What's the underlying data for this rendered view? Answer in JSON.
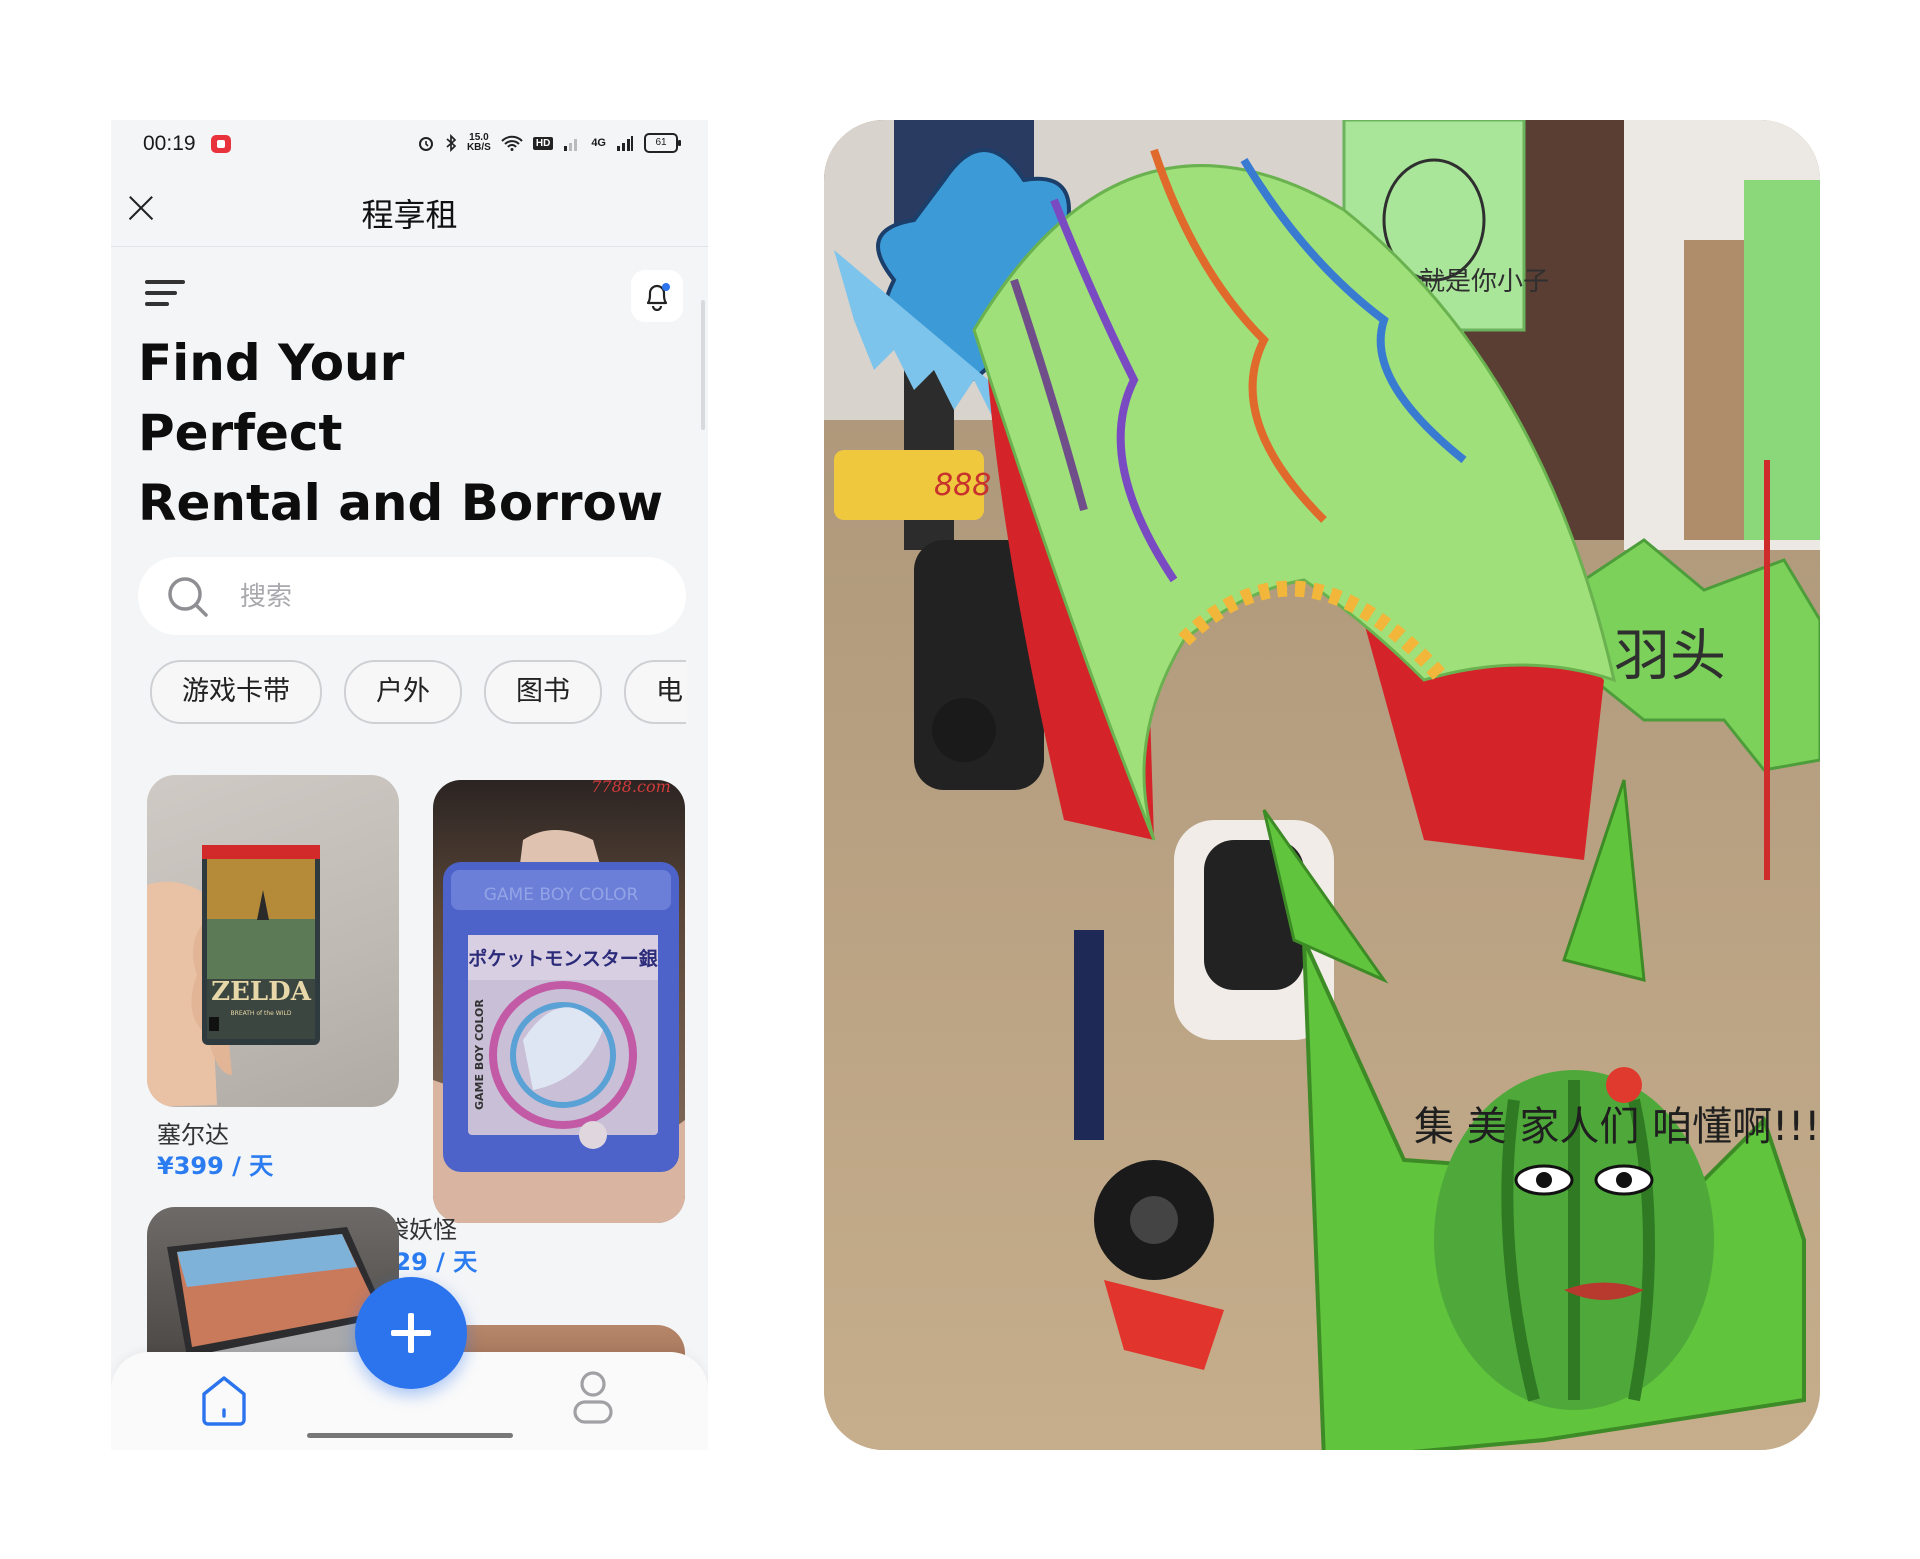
{
  "status_bar": {
    "time": "00:19",
    "net_speed_value": "15.0",
    "net_speed_unit": "KB/S",
    "hd_badge": "HD",
    "network": "4G",
    "battery": "61"
  },
  "header": {
    "title": "程享租"
  },
  "hero": {
    "line1": "Find Your",
    "line2": "Perfect",
    "line3": "Rental and Borrow"
  },
  "search": {
    "placeholder": "搜索"
  },
  "categories": [
    {
      "label": "游戏卡带"
    },
    {
      "label": "户外"
    },
    {
      "label": "图书"
    },
    {
      "label": "电"
    }
  ],
  "items": [
    {
      "name": "塞尔达",
      "price": "¥399 / 天",
      "cover_text": "ZELDA",
      "cover_subtext": "BREATH of the WILD"
    },
    {
      "name": "口袋妖怪",
      "price": "¥229 / 天",
      "watermark": "7788.com",
      "cart_brand": "GAME BOY COLOR",
      "cart_title": "ポケットモンスター銀",
      "cart_side": "GAME BOY COLOR"
    }
  ],
  "photo": {
    "sign_face_text": "集  美\n家人们  咱懂啊!!!",
    "sign_right": "羽头",
    "sign_top": "就是你小子",
    "kart_number": "888"
  },
  "colors": {
    "accent": "#2b74ee",
    "price": "#2b7cf0",
    "background": "#f4f5f7"
  }
}
